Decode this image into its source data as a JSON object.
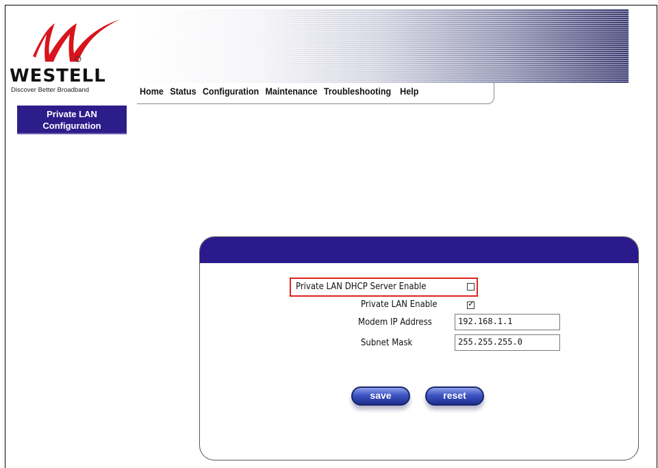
{
  "brand": {
    "name": "WESTELL",
    "tagline": "Discover  Better Broadband"
  },
  "nav": {
    "items": [
      "Home",
      "Status",
      "Configuration",
      "Maintenance",
      "Troubleshooting",
      "Help"
    ]
  },
  "sidebar": {
    "active_line1": "Private LAN",
    "active_line2": "Configuration"
  },
  "form": {
    "dhcp_label": "Private LAN DHCP Server Enable",
    "dhcp_checked": false,
    "lan_enable_label": "Private LAN Enable",
    "lan_enable_checked": true,
    "modem_ip_label": "Modem IP Address",
    "modem_ip_value": "192.168.1.1",
    "subnet_label": "Subnet Mask",
    "subnet_value": "255.255.255.0"
  },
  "buttons": {
    "save": "save",
    "reset": "reset"
  },
  "colors": {
    "accent": "#2a1a8c",
    "highlight": "#e02020",
    "logo_red": "#d8141c"
  }
}
